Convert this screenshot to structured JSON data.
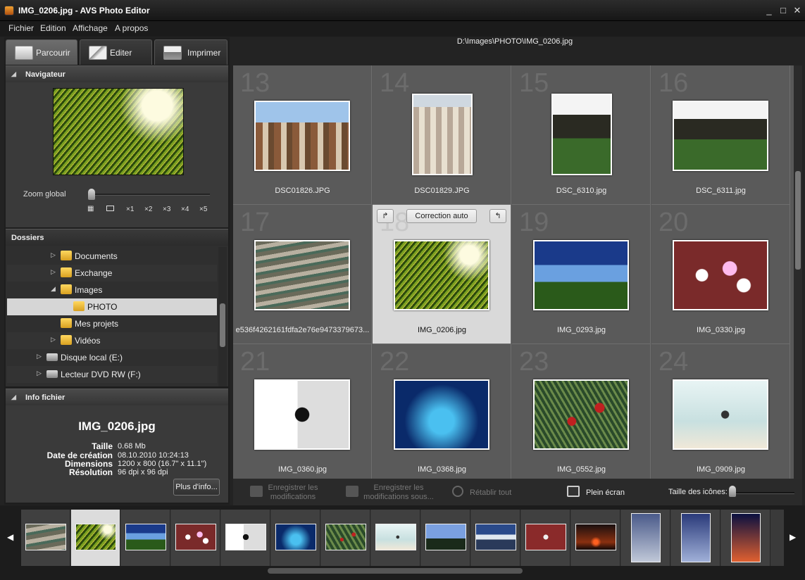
{
  "window": {
    "title": "IMG_0206.jpg  -  AVS Photo Editor",
    "minimize": "_",
    "maximize": "□",
    "close": "✕"
  },
  "menu": [
    {
      "label": "Fichier"
    },
    {
      "label": "Edition"
    },
    {
      "label": "Affichage"
    },
    {
      "label": "A propos"
    }
  ],
  "tabs": [
    {
      "label": "Parcourir",
      "active": true
    },
    {
      "label": "Editer"
    },
    {
      "label": "Imprimer"
    }
  ],
  "navigator": {
    "title": "Navigateur",
    "zoom_label": "Zoom global",
    "zoom_value": 0,
    "zoom_buttons": [
      "×1",
      "×2",
      "×3",
      "×4",
      "×5"
    ]
  },
  "folders": {
    "title": "Dossiers",
    "items": [
      {
        "label": "Documents",
        "level": 1,
        "expander": "▷"
      },
      {
        "label": "Exchange",
        "level": 1,
        "expander": "▷"
      },
      {
        "label": "Images",
        "level": 1,
        "expander": "◢"
      },
      {
        "label": "PHOTO",
        "level": 2,
        "expander": "",
        "selected": true
      },
      {
        "label": "Mes projets",
        "level": 1,
        "expander": ""
      },
      {
        "label": "Vidéos",
        "level": 1,
        "expander": "▷"
      },
      {
        "label": "Disque local (E:)",
        "level": 0,
        "expander": "▷",
        "drive": true
      },
      {
        "label": "Lecteur DVD RW (F:)",
        "level": 0,
        "expander": "▷",
        "drive": true
      }
    ]
  },
  "file_info": {
    "title": "Info fichier",
    "name": "IMG_0206.jpg",
    "rows": [
      {
        "k": "Taille",
        "v": "0.68 Mb"
      },
      {
        "k": "Date de création",
        "v": "08.10.2010   10:24:13"
      },
      {
        "k": "Dimensions",
        "v": "1200 x 800 (16.7\" x 11.1\")"
      },
      {
        "k": "Résolution",
        "v": "96 dpi x 96 dpi"
      }
    ],
    "more_button": "Plus d'info..."
  },
  "path": "D:\\Images\\PHOTO\\IMG_0206.jpg",
  "grid": {
    "correction_button": "Correction auto",
    "rotate_left": "↱",
    "rotate_right": "↰",
    "cells": [
      {
        "num": "13",
        "name": "DSC01826.JPG",
        "thumb": "t-city"
      },
      {
        "num": "14",
        "name": "DSC01829.JPG",
        "thumb": "t-city2",
        "portrait": true
      },
      {
        "num": "15",
        "name": "DSC_6310.jpg",
        "thumb": "t-temple",
        "portrait": true
      },
      {
        "num": "16",
        "name": "DSC_6311.jpg",
        "thumb": "t-temple"
      },
      {
        "num": "17",
        "name": "e536f4262161fdfa2e76e9473379673...",
        "thumb": "t-stone"
      },
      {
        "num": "18",
        "name": "IMG_0206.jpg",
        "thumb": "t-palm",
        "selected": true
      },
      {
        "num": "19",
        "name": "IMG_0293.jpg",
        "thumb": "t-tropic"
      },
      {
        "num": "20",
        "name": "IMG_0330.jpg",
        "thumb": "t-flowers"
      },
      {
        "num": "21",
        "name": "IMG_0360.jpg",
        "thumb": "t-bird"
      },
      {
        "num": "22",
        "name": "IMG_0368.jpg",
        "thumb": "t-water"
      },
      {
        "num": "23",
        "name": "IMG_0552.jpg",
        "thumb": "t-berries"
      },
      {
        "num": "24",
        "name": "IMG_0909.jpg",
        "thumb": "t-heron"
      }
    ]
  },
  "toolbar": {
    "save": "Enregistrer les\nmodifications",
    "save_as": "Enregistrer les\nmodifications sous...",
    "restore": "Rétablir tout",
    "fullscreen": "Plein écran",
    "icon_size": "Taille des icônes:",
    "icon_size_value": 0
  },
  "filmstrip": {
    "left_arrow": "◀",
    "right_arrow": "▶",
    "items": [
      "t-stone",
      "t-palm",
      "t-tropic",
      "t-flowers",
      "t-bird",
      "t-water",
      "t-berries",
      "t-heron",
      "t-palmtrees",
      "t-wave",
      "t-red",
      "t-sunset",
      "t-tree1",
      "t-tree2",
      "t-tree3"
    ],
    "selected": 1
  },
  "colors": {
    "accent": "#d6d6d6",
    "background": "#232323"
  }
}
